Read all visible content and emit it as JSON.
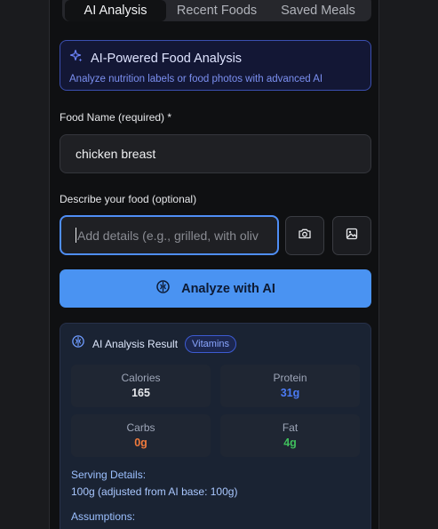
{
  "tabs": [
    {
      "label": "AI Analysis",
      "active": true
    },
    {
      "label": "Recent Foods",
      "active": false
    },
    {
      "label": "Saved Meals",
      "active": false
    }
  ],
  "ai_banner": {
    "title": "AI-Powered Food Analysis",
    "subtitle": "Analyze nutrition labels or food photos with advanced AI",
    "icon": "sparkles-icon"
  },
  "food_name": {
    "label": "Food Name (required) *",
    "value": "chicken breast"
  },
  "description": {
    "label": "Describe your food (optional)",
    "placeholder": "Add details (e.g., grilled, with oliv"
  },
  "actions": {
    "camera_icon": "camera-icon",
    "image_icon": "image-icon",
    "analyze_label": "Analyze with AI"
  },
  "result": {
    "title": "AI Analysis Result",
    "badge": "Vitamins",
    "stats": [
      {
        "label": "Calories",
        "value": "165",
        "color": "#e6e8ec"
      },
      {
        "label": "Protein",
        "value": "31g",
        "color": "#4b7bf5"
      },
      {
        "label": "Carbs",
        "value": "0g",
        "color": "#f07a3c"
      },
      {
        "label": "Fat",
        "value": "4g",
        "color": "#3fbf5c"
      }
    ],
    "serving_label": "Serving Details:",
    "serving_value": "100g (adjusted from AI base: 100g)",
    "assumptions_label": "Assumptions:"
  },
  "colors": {
    "accent": "#4a93f2",
    "banner_border": "#3b4fb0",
    "panel_bg": "#0f1012"
  }
}
